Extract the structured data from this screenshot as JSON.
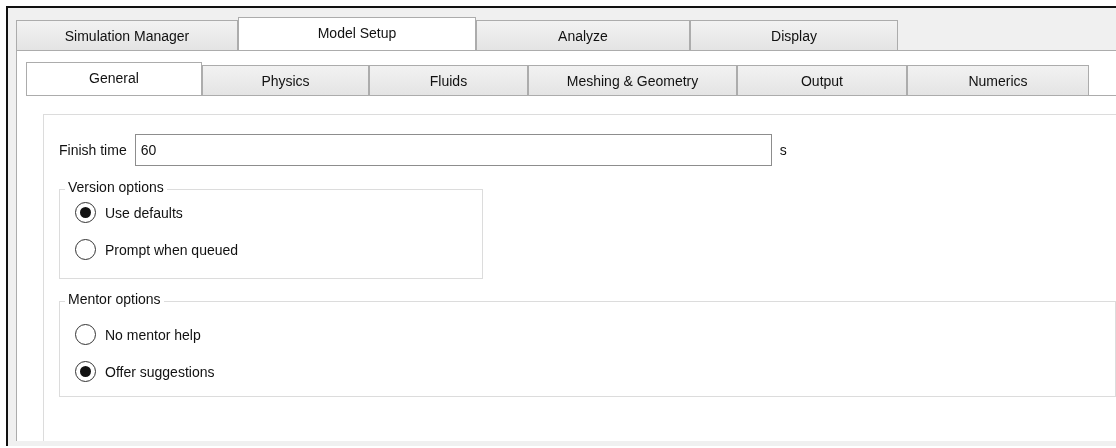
{
  "main_tabs": [
    {
      "label": "Simulation Manager",
      "selected": false
    },
    {
      "label": "Model Setup",
      "selected": true
    },
    {
      "label": "Analyze",
      "selected": false
    },
    {
      "label": "Display",
      "selected": false
    }
  ],
  "sub_tabs": [
    {
      "label": "General",
      "selected": true
    },
    {
      "label": "Physics",
      "selected": false
    },
    {
      "label": "Fluids",
      "selected": false
    },
    {
      "label": "Meshing & Geometry",
      "selected": false
    },
    {
      "label": "Output",
      "selected": false
    },
    {
      "label": "Numerics",
      "selected": false
    }
  ],
  "finish_time": {
    "label": "Finish time",
    "value": "60",
    "unit": "s"
  },
  "groups": [
    {
      "title": "Version options",
      "options": [
        {
          "label": "Use defaults",
          "selected": true
        },
        {
          "label": "Prompt when queued",
          "selected": false
        }
      ]
    },
    {
      "title": "Mentor options",
      "options": [
        {
          "label": "No mentor help",
          "selected": false
        },
        {
          "label": "Offer suggestions",
          "selected": true
        }
      ]
    }
  ]
}
